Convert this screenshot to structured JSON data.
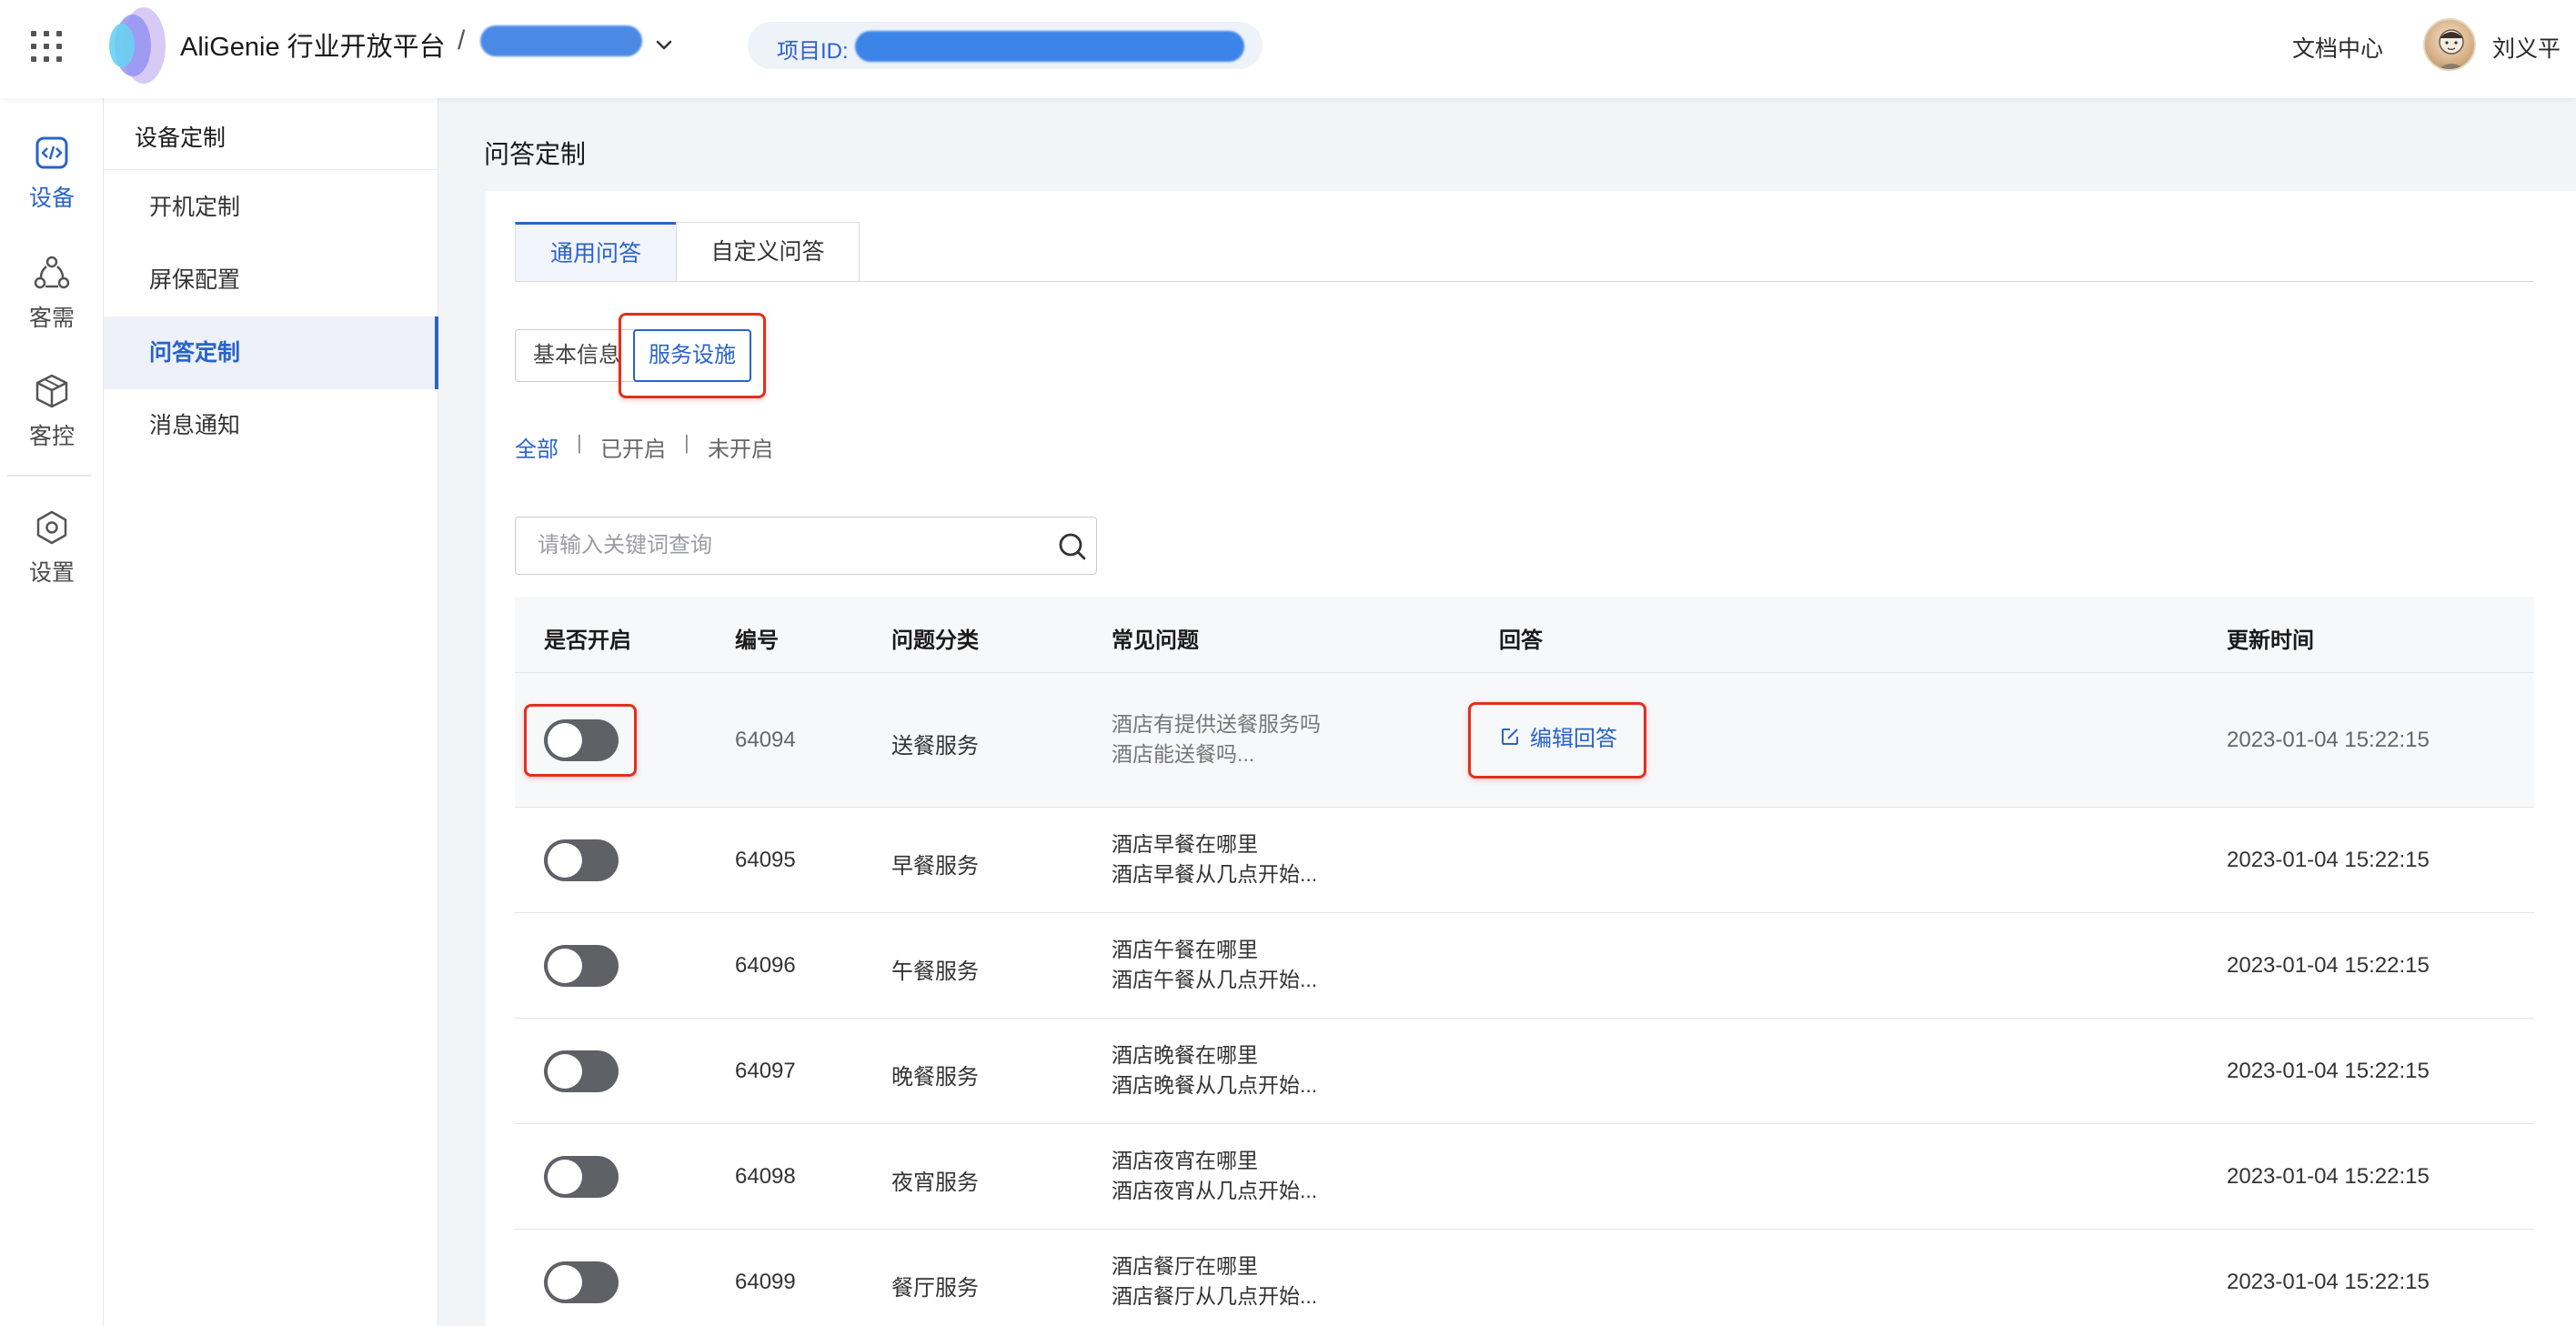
{
  "header": {
    "brand": "AliGenie 行业开放平台",
    "separator": "/",
    "project_id_label": "项目ID:",
    "doc_center": "文档中心",
    "username": "刘义平"
  },
  "rail": {
    "items": [
      {
        "label": "设备",
        "icon": "code-box-icon",
        "active": true
      },
      {
        "label": "客需",
        "icon": "users-triangle-icon",
        "active": false
      },
      {
        "label": "客控",
        "icon": "cube-icon",
        "active": false
      },
      {
        "label": "设置",
        "icon": "hexagon-gear-icon",
        "active": false
      }
    ]
  },
  "sidebar": {
    "title": "设备定制",
    "items": [
      {
        "label": "开机定制"
      },
      {
        "label": "屏保配置"
      },
      {
        "label": "问答定制"
      },
      {
        "label": "消息通知"
      }
    ],
    "active_index": 2
  },
  "main": {
    "page_title": "问答定制",
    "tabs": [
      {
        "label": "通用问答"
      },
      {
        "label": "自定义问答"
      }
    ],
    "segments": [
      {
        "label": "基本信息"
      },
      {
        "label": "服务设施"
      }
    ],
    "filters": [
      {
        "label": "全部"
      },
      {
        "label": "已开启"
      },
      {
        "label": "未开启"
      }
    ],
    "filter_separator": "|",
    "search": {
      "placeholder": "请输入关键词查询",
      "value": ""
    },
    "table": {
      "columns": [
        "是否开启",
        "编号",
        "问题分类",
        "常见问题",
        "回答",
        "更新时间"
      ],
      "rows": [
        {
          "enabled": false,
          "id": "64094",
          "category": "送餐服务",
          "q1": "酒店有提供送餐服务吗",
          "q2": "酒店能送餐吗...",
          "answer": "编辑回答",
          "updated": "2023-01-04 15:22:15"
        },
        {
          "enabled": false,
          "id": "64095",
          "category": "早餐服务",
          "q1": "酒店早餐在哪里",
          "q2": "酒店早餐从几点开始...",
          "answer": "",
          "updated": "2023-01-04 15:22:15"
        },
        {
          "enabled": false,
          "id": "64096",
          "category": "午餐服务",
          "q1": "酒店午餐在哪里",
          "q2": "酒店午餐从几点开始...",
          "answer": "",
          "updated": "2023-01-04 15:22:15"
        },
        {
          "enabled": false,
          "id": "64097",
          "category": "晚餐服务",
          "q1": "酒店晚餐在哪里",
          "q2": "酒店晚餐从几点开始...",
          "answer": "",
          "updated": "2023-01-04 15:22:15"
        },
        {
          "enabled": false,
          "id": "64098",
          "category": "夜宵服务",
          "q1": "酒店夜宵在哪里",
          "q2": "酒店夜宵从几点开始...",
          "answer": "",
          "updated": "2023-01-04 15:22:15"
        },
        {
          "enabled": false,
          "id": "64099",
          "category": "餐厅服务",
          "q1": "酒店餐厅在哪里",
          "q2": "酒店餐厅从几点开始...",
          "answer": "",
          "updated": "2023-01-04 15:22:15"
        }
      ]
    }
  },
  "colors": {
    "accent": "#2a63c9",
    "highlight": "#e0301e",
    "switch_off": "#5f6166"
  }
}
